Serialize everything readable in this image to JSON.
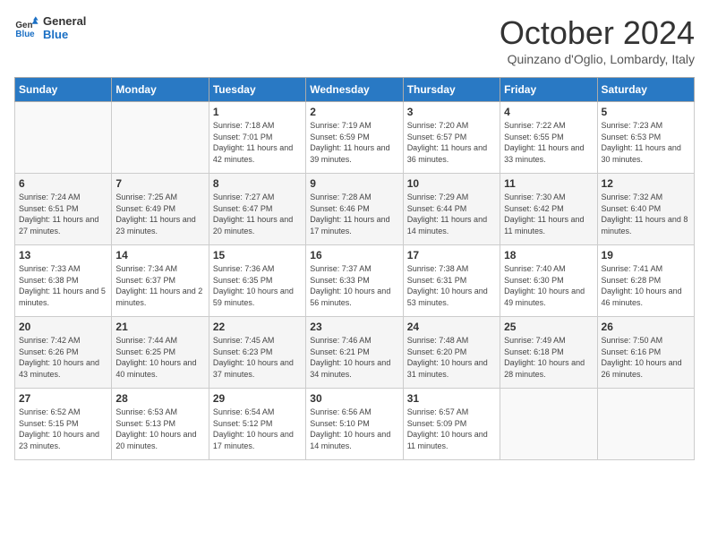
{
  "header": {
    "logo_line1": "General",
    "logo_line2": "Blue",
    "month_title": "October 2024",
    "location": "Quinzano d'Oglio, Lombardy, Italy"
  },
  "days_of_week": [
    "Sunday",
    "Monday",
    "Tuesday",
    "Wednesday",
    "Thursday",
    "Friday",
    "Saturday"
  ],
  "weeks": [
    [
      {
        "day": "",
        "sunrise": "",
        "sunset": "",
        "daylight": ""
      },
      {
        "day": "",
        "sunrise": "",
        "sunset": "",
        "daylight": ""
      },
      {
        "day": "1",
        "sunrise": "Sunrise: 7:18 AM",
        "sunset": "Sunset: 7:01 PM",
        "daylight": "Daylight: 11 hours and 42 minutes."
      },
      {
        "day": "2",
        "sunrise": "Sunrise: 7:19 AM",
        "sunset": "Sunset: 6:59 PM",
        "daylight": "Daylight: 11 hours and 39 minutes."
      },
      {
        "day": "3",
        "sunrise": "Sunrise: 7:20 AM",
        "sunset": "Sunset: 6:57 PM",
        "daylight": "Daylight: 11 hours and 36 minutes."
      },
      {
        "day": "4",
        "sunrise": "Sunrise: 7:22 AM",
        "sunset": "Sunset: 6:55 PM",
        "daylight": "Daylight: 11 hours and 33 minutes."
      },
      {
        "day": "5",
        "sunrise": "Sunrise: 7:23 AM",
        "sunset": "Sunset: 6:53 PM",
        "daylight": "Daylight: 11 hours and 30 minutes."
      }
    ],
    [
      {
        "day": "6",
        "sunrise": "Sunrise: 7:24 AM",
        "sunset": "Sunset: 6:51 PM",
        "daylight": "Daylight: 11 hours and 27 minutes."
      },
      {
        "day": "7",
        "sunrise": "Sunrise: 7:25 AM",
        "sunset": "Sunset: 6:49 PM",
        "daylight": "Daylight: 11 hours and 23 minutes."
      },
      {
        "day": "8",
        "sunrise": "Sunrise: 7:27 AM",
        "sunset": "Sunset: 6:47 PM",
        "daylight": "Daylight: 11 hours and 20 minutes."
      },
      {
        "day": "9",
        "sunrise": "Sunrise: 7:28 AM",
        "sunset": "Sunset: 6:46 PM",
        "daylight": "Daylight: 11 hours and 17 minutes."
      },
      {
        "day": "10",
        "sunrise": "Sunrise: 7:29 AM",
        "sunset": "Sunset: 6:44 PM",
        "daylight": "Daylight: 11 hours and 14 minutes."
      },
      {
        "day": "11",
        "sunrise": "Sunrise: 7:30 AM",
        "sunset": "Sunset: 6:42 PM",
        "daylight": "Daylight: 11 hours and 11 minutes."
      },
      {
        "day": "12",
        "sunrise": "Sunrise: 7:32 AM",
        "sunset": "Sunset: 6:40 PM",
        "daylight": "Daylight: 11 hours and 8 minutes."
      }
    ],
    [
      {
        "day": "13",
        "sunrise": "Sunrise: 7:33 AM",
        "sunset": "Sunset: 6:38 PM",
        "daylight": "Daylight: 11 hours and 5 minutes."
      },
      {
        "day": "14",
        "sunrise": "Sunrise: 7:34 AM",
        "sunset": "Sunset: 6:37 PM",
        "daylight": "Daylight: 11 hours and 2 minutes."
      },
      {
        "day": "15",
        "sunrise": "Sunrise: 7:36 AM",
        "sunset": "Sunset: 6:35 PM",
        "daylight": "Daylight: 10 hours and 59 minutes."
      },
      {
        "day": "16",
        "sunrise": "Sunrise: 7:37 AM",
        "sunset": "Sunset: 6:33 PM",
        "daylight": "Daylight: 10 hours and 56 minutes."
      },
      {
        "day": "17",
        "sunrise": "Sunrise: 7:38 AM",
        "sunset": "Sunset: 6:31 PM",
        "daylight": "Daylight: 10 hours and 53 minutes."
      },
      {
        "day": "18",
        "sunrise": "Sunrise: 7:40 AM",
        "sunset": "Sunset: 6:30 PM",
        "daylight": "Daylight: 10 hours and 49 minutes."
      },
      {
        "day": "19",
        "sunrise": "Sunrise: 7:41 AM",
        "sunset": "Sunset: 6:28 PM",
        "daylight": "Daylight: 10 hours and 46 minutes."
      }
    ],
    [
      {
        "day": "20",
        "sunrise": "Sunrise: 7:42 AM",
        "sunset": "Sunset: 6:26 PM",
        "daylight": "Daylight: 10 hours and 43 minutes."
      },
      {
        "day": "21",
        "sunrise": "Sunrise: 7:44 AM",
        "sunset": "Sunset: 6:25 PM",
        "daylight": "Daylight: 10 hours and 40 minutes."
      },
      {
        "day": "22",
        "sunrise": "Sunrise: 7:45 AM",
        "sunset": "Sunset: 6:23 PM",
        "daylight": "Daylight: 10 hours and 37 minutes."
      },
      {
        "day": "23",
        "sunrise": "Sunrise: 7:46 AM",
        "sunset": "Sunset: 6:21 PM",
        "daylight": "Daylight: 10 hours and 34 minutes."
      },
      {
        "day": "24",
        "sunrise": "Sunrise: 7:48 AM",
        "sunset": "Sunset: 6:20 PM",
        "daylight": "Daylight: 10 hours and 31 minutes."
      },
      {
        "day": "25",
        "sunrise": "Sunrise: 7:49 AM",
        "sunset": "Sunset: 6:18 PM",
        "daylight": "Daylight: 10 hours and 28 minutes."
      },
      {
        "day": "26",
        "sunrise": "Sunrise: 7:50 AM",
        "sunset": "Sunset: 6:16 PM",
        "daylight": "Daylight: 10 hours and 26 minutes."
      }
    ],
    [
      {
        "day": "27",
        "sunrise": "Sunrise: 6:52 AM",
        "sunset": "Sunset: 5:15 PM",
        "daylight": "Daylight: 10 hours and 23 minutes."
      },
      {
        "day": "28",
        "sunrise": "Sunrise: 6:53 AM",
        "sunset": "Sunset: 5:13 PM",
        "daylight": "Daylight: 10 hours and 20 minutes."
      },
      {
        "day": "29",
        "sunrise": "Sunrise: 6:54 AM",
        "sunset": "Sunset: 5:12 PM",
        "daylight": "Daylight: 10 hours and 17 minutes."
      },
      {
        "day": "30",
        "sunrise": "Sunrise: 6:56 AM",
        "sunset": "Sunset: 5:10 PM",
        "daylight": "Daylight: 10 hours and 14 minutes."
      },
      {
        "day": "31",
        "sunrise": "Sunrise: 6:57 AM",
        "sunset": "Sunset: 5:09 PM",
        "daylight": "Daylight: 10 hours and 11 minutes."
      },
      {
        "day": "",
        "sunrise": "",
        "sunset": "",
        "daylight": ""
      },
      {
        "day": "",
        "sunrise": "",
        "sunset": "",
        "daylight": ""
      }
    ]
  ]
}
